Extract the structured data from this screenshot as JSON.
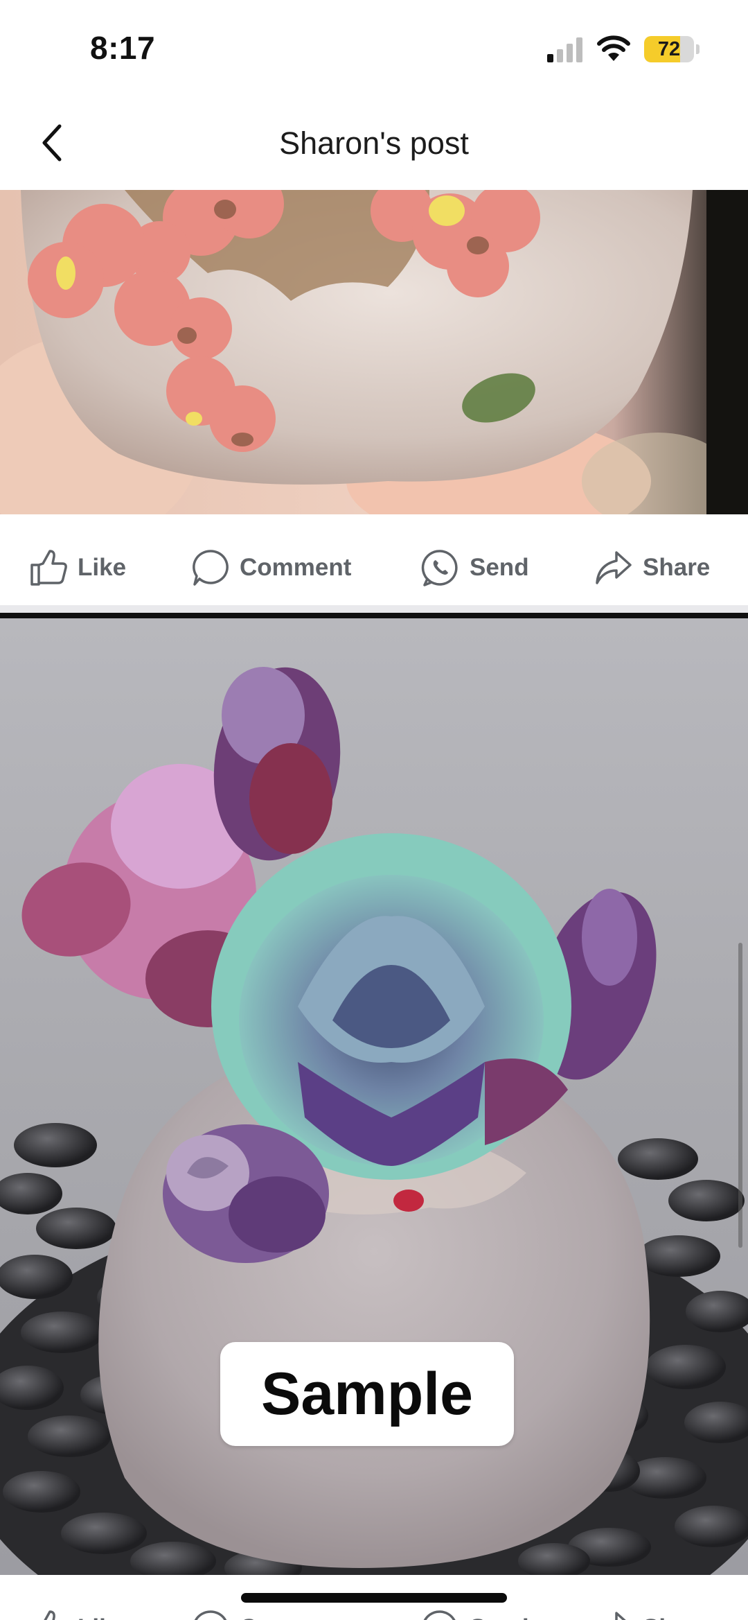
{
  "status_bar": {
    "time": "8:17",
    "battery_level": "72",
    "battery_fraction": 0.72,
    "signal_bars_active": 1,
    "signal_bars_total": 4,
    "colors": {
      "battery_fill": "#f5cc2a"
    }
  },
  "header": {
    "title": "Sharon's post",
    "back_icon": "chevron-left-icon"
  },
  "post_actions": [
    {
      "label": "Like",
      "icon": "thumbs-up-icon"
    },
    {
      "label": "Comment",
      "icon": "comment-bubble-icon"
    },
    {
      "label": "Send",
      "icon": "messenger-icon"
    },
    {
      "label": "Share",
      "icon": "share-arrow-icon"
    }
  ],
  "photos": [
    {
      "alt": "ceramic flower pot close-up",
      "icon": "photo"
    },
    {
      "alt": "succulent in rock pot",
      "overlay_label": "Sample"
    }
  ],
  "theme": {
    "text_primary": "#1c1c1c",
    "action_text": "#5f6368",
    "divider": "#e9e9ec"
  }
}
